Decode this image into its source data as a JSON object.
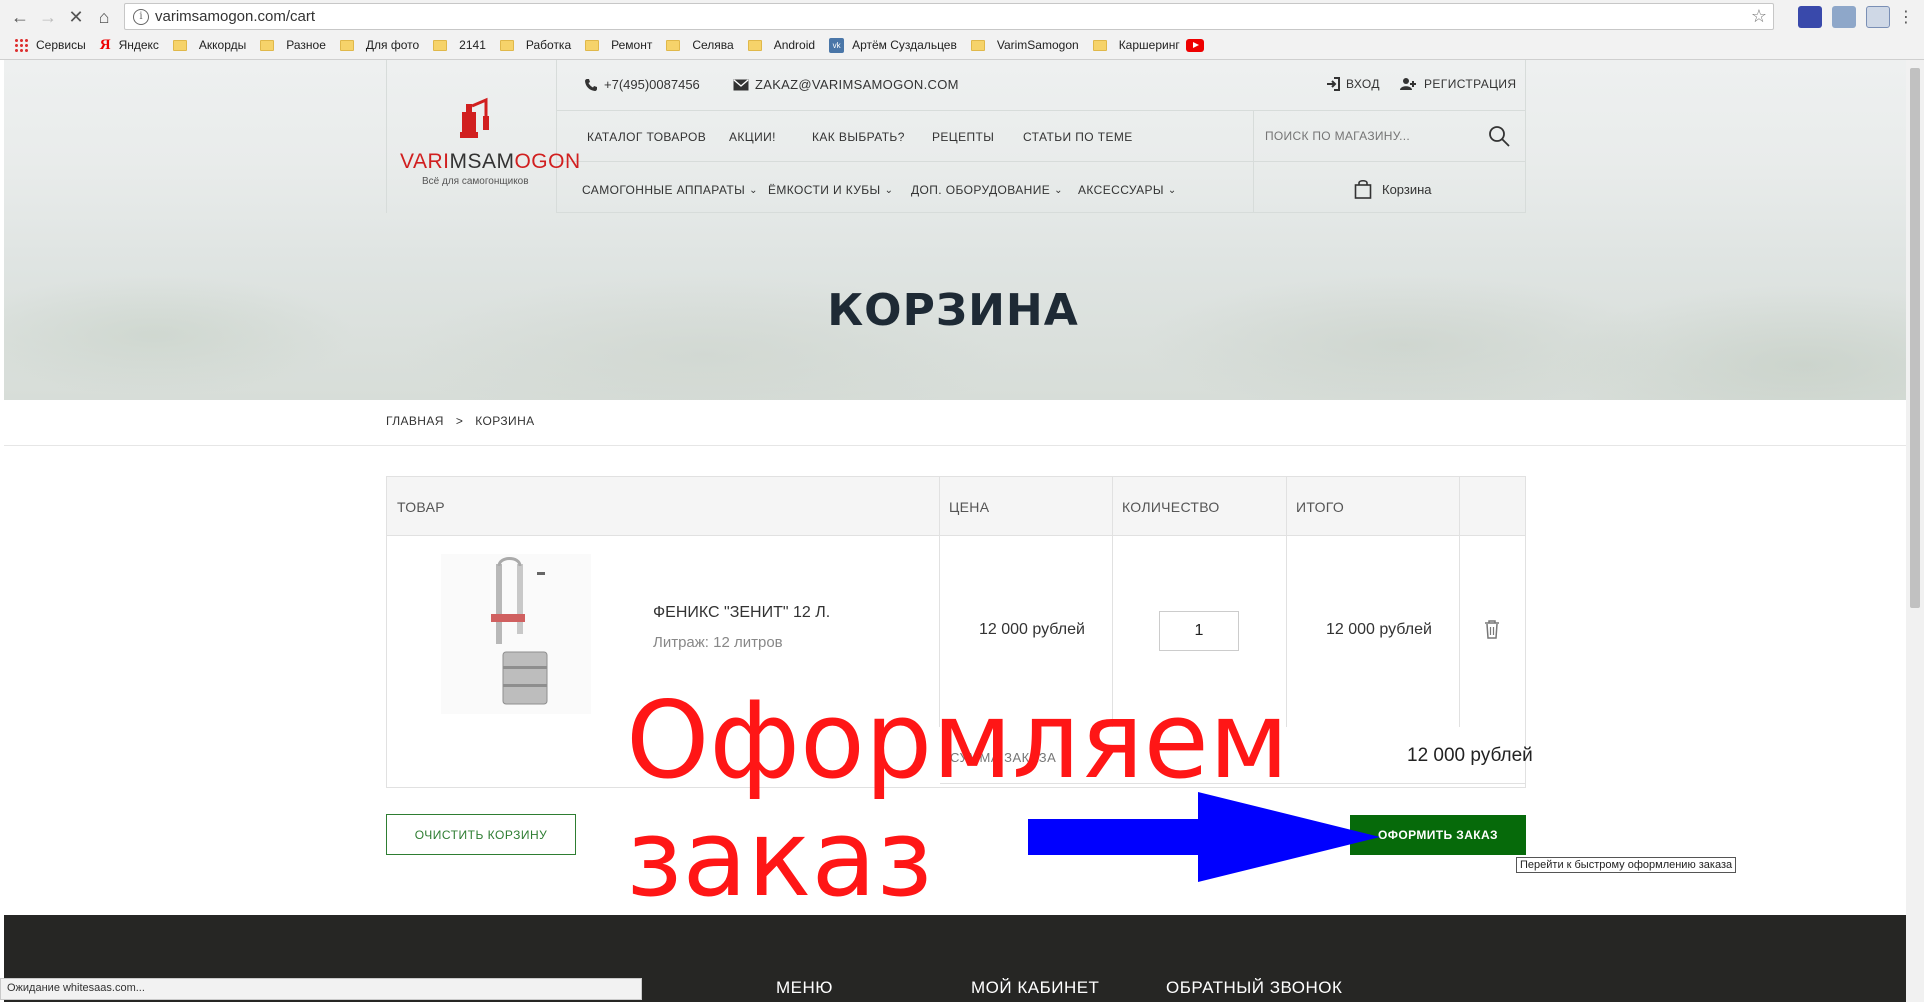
{
  "browser": {
    "url": "varimsamogon.com/cart",
    "bookmarks": [
      "Сервисы",
      "Яндекс",
      "Аккорды",
      "Разное",
      "Для фото",
      "2141",
      "Работка",
      "Ремонт",
      "Селява",
      "Android",
      "Артём Суздальцев",
      "VarimSamogon",
      "Каршеринг"
    ],
    "status_text": "Ожидание whitesaas.com..."
  },
  "header": {
    "logo_main_red1": "VARI",
    "logo_main_dark": "MSAM",
    "logo_main_red2": "OGON",
    "logo_sub": "Всё для самогонщиков",
    "phone": "+7(495)0087456",
    "email": "ZAKAZ@VARIMSAMOGON.COM",
    "login": "ВХОД",
    "register": "РЕГИСТРАЦИЯ",
    "menu_top": [
      "КАТАЛОГ ТОВАРОВ",
      "АКЦИИ!",
      "КАК ВЫБРАТЬ?",
      "РЕЦЕПТЫ",
      "СТАТЬИ ПО ТЕМЕ"
    ],
    "menu_bottom": [
      "САМОГОННЫЕ АППАРАТЫ",
      "ЁМКОСТИ И КУБЫ",
      "ДОП. ОБОРУДОВАНИЕ",
      "АКСЕССУАРЫ"
    ],
    "search_placeholder": "ПОИСК ПО МАГАЗИНУ...",
    "cart_label": "Корзина"
  },
  "page": {
    "title": "КОРЗИНА",
    "breadcrumbs": [
      "ГЛАВНАЯ",
      "КОРЗИНА"
    ],
    "breadcrumb_sep": ">"
  },
  "cart": {
    "columns": [
      "ТОВАР",
      "ЦЕНА",
      "КОЛИЧЕСТВО",
      "ИТОГО"
    ],
    "items": [
      {
        "name": "ФЕНИКС \"ЗЕНИТ\" 12 Л.",
        "attr": "Литраж: 12 литров",
        "price": "12 000 рублей",
        "qty": "1",
        "total": "12 000 рублей"
      }
    ],
    "sum_label": "СУММА ЗАКАЗА",
    "sum_value": "12 000 рублей",
    "clear_button": "ОЧИСТИТЬ КОРЗИНУ",
    "checkout_button": "ОФОРМИТЬ ЗАКАЗ",
    "checkout_tooltip": "Перейти к быстрому оформлению заказа"
  },
  "annotation": {
    "line1": "Оформляем",
    "line2": "заказ",
    "arrow_color": "#0000ff",
    "text_color": "#ff1616"
  },
  "footer": {
    "cols": [
      "МЕНЮ",
      "МОЙ КАБИНЕТ",
      "ОБРАТНЫЙ ЗВОНОК"
    ]
  },
  "colors": {
    "accent_green": "#066a0a",
    "logo_red": "#d11f1f"
  }
}
